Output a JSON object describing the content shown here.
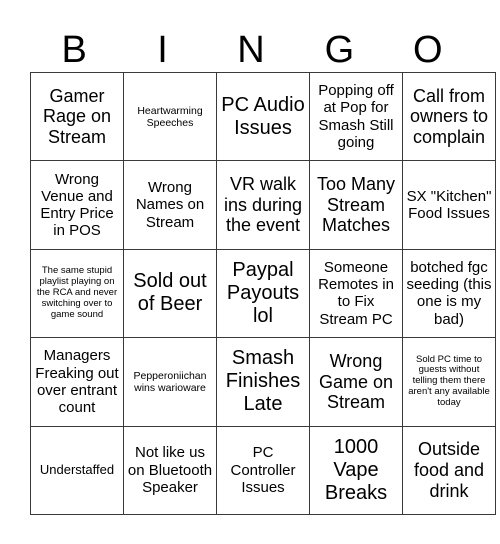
{
  "header": {
    "letters": [
      "B",
      "I",
      "N",
      "G",
      "O"
    ]
  },
  "board": {
    "rows": [
      [
        {
          "text": "Gamer Rage on Stream",
          "size": "lg"
        },
        {
          "text": "Heartwarming Speeches",
          "size": "xs"
        },
        {
          "text": "PC Audio Issues",
          "size": "xl"
        },
        {
          "text": "Popping off at Pop for Smash Still going",
          "size": "md"
        },
        {
          "text": "Call from owners to complain",
          "size": "lg"
        }
      ],
      [
        {
          "text": "Wrong Venue and Entry Price in POS",
          "size": "md"
        },
        {
          "text": "Wrong Names on Stream",
          "size": "md"
        },
        {
          "text": "VR walk ins during the event",
          "size": "lg"
        },
        {
          "text": "Too Many Stream Matches",
          "size": "lg"
        },
        {
          "text": "SX \"Kitchen\" Food Issues",
          "size": "md"
        }
      ],
      [
        {
          "text": "The same stupid playlist playing on the RCA and never switching over to game sound",
          "size": "xxs"
        },
        {
          "text": "Sold out of Beer",
          "size": "xl"
        },
        {
          "text": "Paypal Payouts lol",
          "size": "xl"
        },
        {
          "text": "Someone Remotes in to Fix Stream PC",
          "size": "md"
        },
        {
          "text": "botched fgc seeding (this one is my bad)",
          "size": "md"
        }
      ],
      [
        {
          "text": "Managers Freaking out over entrant count",
          "size": "md"
        },
        {
          "text": "Pepperoniichan wins warioware",
          "size": "xs"
        },
        {
          "text": "Smash Finishes Late",
          "size": "xl"
        },
        {
          "text": "Wrong Game on Stream",
          "size": "lg"
        },
        {
          "text": "Sold PC time to guests without telling them there aren't any available today",
          "size": "xxs"
        }
      ],
      [
        {
          "text": "Understaffed",
          "size": "sm"
        },
        {
          "text": "Not like us on Bluetooth Speaker",
          "size": "md"
        },
        {
          "text": "PC Controller Issues",
          "size": "md"
        },
        {
          "text": "1000 Vape Breaks",
          "size": "xl"
        },
        {
          "text": "Outside food and drink",
          "size": "lg"
        }
      ]
    ]
  }
}
